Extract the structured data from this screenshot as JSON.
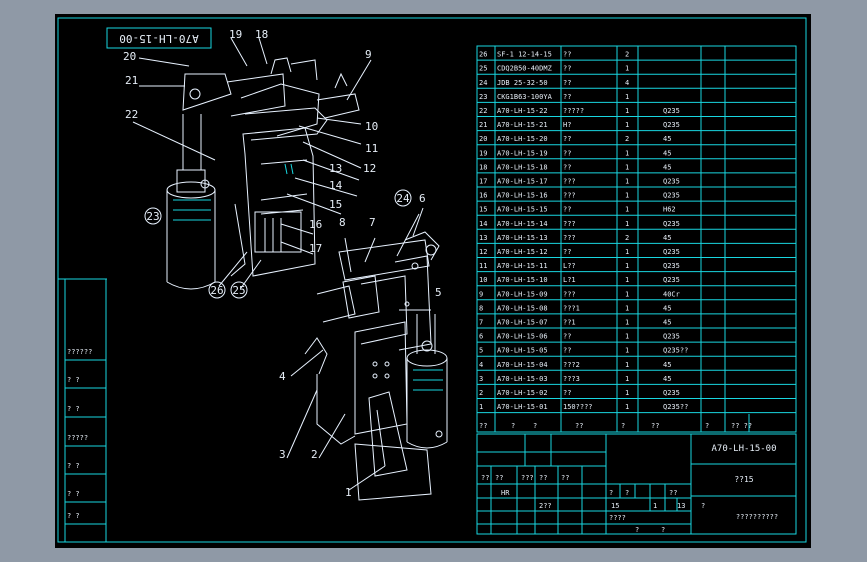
{
  "drawing": {
    "rotated_code": "A70-LH-15-00",
    "callouts": [
      "1",
      "2",
      "3",
      "4",
      "5",
      "6",
      "7",
      "8",
      "9",
      "10",
      "11",
      "12",
      "13",
      "14",
      "15",
      "16",
      "17",
      "18",
      "19",
      "20",
      "21",
      "22",
      "23",
      "24",
      "25",
      "26"
    ],
    "circled_callouts": [
      "23",
      "24",
      "25",
      "26"
    ]
  },
  "bom": {
    "rows": [
      [
        "26",
        "SF-1 12-14-15",
        "??",
        "2",
        ""
      ],
      [
        "25",
        "CDQ2B50-40DMZ",
        "??",
        "1",
        ""
      ],
      [
        "24",
        "JDB 25-32-50",
        "??",
        "4",
        ""
      ],
      [
        "23",
        "CKG1B63-100YA",
        "??",
        "1",
        ""
      ],
      [
        "22",
        "A70-LH-15-22",
        "?????",
        "1",
        "Q235"
      ],
      [
        "21",
        "A70-LH-15-21",
        "H?",
        "1",
        "Q235"
      ],
      [
        "20",
        "A70-LH-15-20",
        "??",
        "2",
        "45"
      ],
      [
        "19",
        "A70-LH-15-19",
        "??",
        "1",
        "45"
      ],
      [
        "18",
        "A70-LH-15-18",
        "??",
        "1",
        "45"
      ],
      [
        "17",
        "A70-LH-15-17",
        "???",
        "1",
        "Q235"
      ],
      [
        "16",
        "A70-LH-15-16",
        "???",
        "1",
        "Q235"
      ],
      [
        "15",
        "A70-LH-15-15",
        "??",
        "1",
        "H62"
      ],
      [
        "14",
        "A70-LH-15-14",
        "???",
        "1",
        "Q235"
      ],
      [
        "13",
        "A70-LH-15-13",
        "???",
        "2",
        "45"
      ],
      [
        "12",
        "A70-LH-15-12",
        "??",
        "1",
        "Q235"
      ],
      [
        "11",
        "A70-LH-15-11",
        "L??",
        "1",
        "Q235"
      ],
      [
        "10",
        "A70-LH-15-10",
        "L?1",
        "1",
        "Q235"
      ],
      [
        "9",
        "A70-LH-15-09",
        "???",
        "1",
        "40Cr"
      ],
      [
        "8",
        "A70-LH-15-08",
        "???1",
        "1",
        "45"
      ],
      [
        "7",
        "A70-LH-15-07",
        "??1",
        "1",
        "45"
      ],
      [
        "6",
        "A70-LH-15-06",
        "??",
        "1",
        "Q235"
      ],
      [
        "5",
        "A70-LH-15-05",
        "??",
        "1",
        "Q235??"
      ],
      [
        "4",
        "A70-LH-15-04",
        "???2",
        "1",
        "45"
      ],
      [
        "3",
        "A70-LH-15-03",
        "???3",
        "1",
        "45"
      ],
      [
        "2",
        "A70-LH-15-02",
        "??",
        "1",
        "Q235"
      ],
      [
        "1",
        "A70-LH-15-01",
        "150????",
        "1",
        "Q235??"
      ]
    ],
    "header": [
      "??",
      "?",
      "?",
      "??",
      "?",
      "??",
      "?",
      "?? ??"
    ]
  },
  "title_block": {
    "drawing_no": "A70-LH-15-00",
    "name": "??15",
    "company": "??????????",
    "row_marks": [
      "??",
      "??",
      "???",
      "??",
      "??",
      "?",
      "?",
      "??"
    ],
    "label_hr": "HR",
    "label_277": "2??",
    "label_15": "15",
    "label_1": "1",
    "label_13": "13",
    "label_a": "????",
    "label_b": "?",
    "label_c": "?",
    "label_d": "?"
  },
  "left_block": {
    "items": [
      "??????",
      "? ?",
      "? ?",
      "?????",
      "? ?",
      "? ?",
      "? ?"
    ]
  }
}
